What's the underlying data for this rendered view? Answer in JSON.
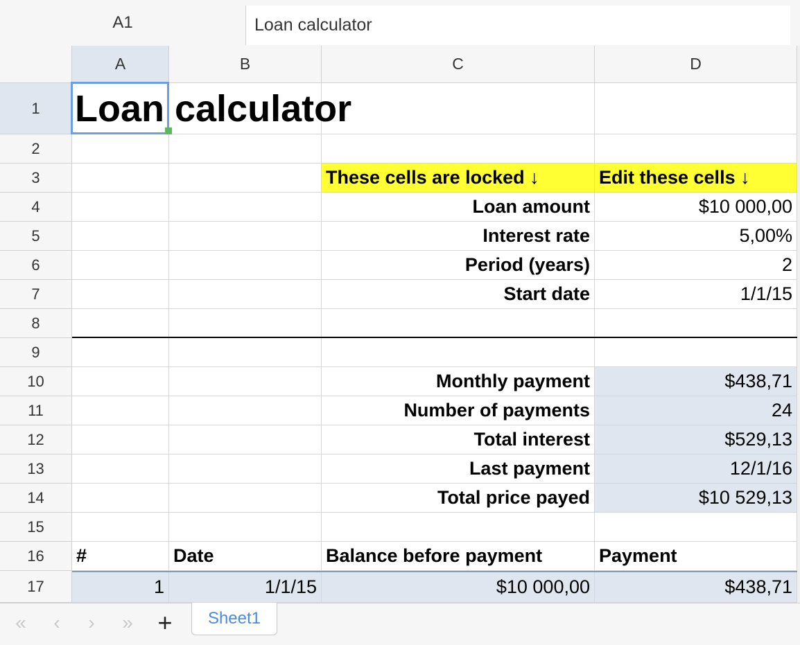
{
  "formula_bar": {
    "cell_ref": "A1",
    "content": "Loan calculator"
  },
  "columns": [
    "A",
    "B",
    "C",
    "D"
  ],
  "rows": [
    "1",
    "2",
    "3",
    "4",
    "5",
    "6",
    "7",
    "8",
    "9",
    "10",
    "11",
    "12",
    "13",
    "14",
    "15",
    "16",
    "17"
  ],
  "sheet": {
    "title": "Loan calculator",
    "locked_header": "These cells are locked ↓",
    "edit_header": "Edit these cells ↓",
    "inputs": [
      {
        "label": "Loan amount",
        "value": "$10 000,00"
      },
      {
        "label": "Interest rate",
        "value": "5,00%"
      },
      {
        "label": "Period (years)",
        "value": "2"
      },
      {
        "label": "Start date",
        "value": "1/1/15"
      }
    ],
    "results": [
      {
        "label": "Monthly payment",
        "value": "$438,71"
      },
      {
        "label": "Number of payments",
        "value": "24"
      },
      {
        "label": "Total interest",
        "value": "$529,13"
      },
      {
        "label": "Last payment",
        "value": "12/1/16"
      },
      {
        "label": "Total price payed",
        "value": "$10 529,13"
      }
    ],
    "table_headers": [
      "#",
      "Date",
      "Balance before payment",
      "Payment"
    ],
    "table_rows": [
      [
        "1",
        "1/1/15",
        "$10 000,00",
        "$438,71"
      ]
    ]
  },
  "tabbar": {
    "first_icon": "«",
    "prev_icon": "‹",
    "next_icon": "›",
    "last_icon": "»",
    "add_icon": "+",
    "sheets": [
      "Sheet1"
    ]
  },
  "colors": {
    "locked_highlight": "#ffff33",
    "computed_fill": "#dfe6ef",
    "selection": "#6a9fe0",
    "tab_text": "#4a8ae0"
  }
}
